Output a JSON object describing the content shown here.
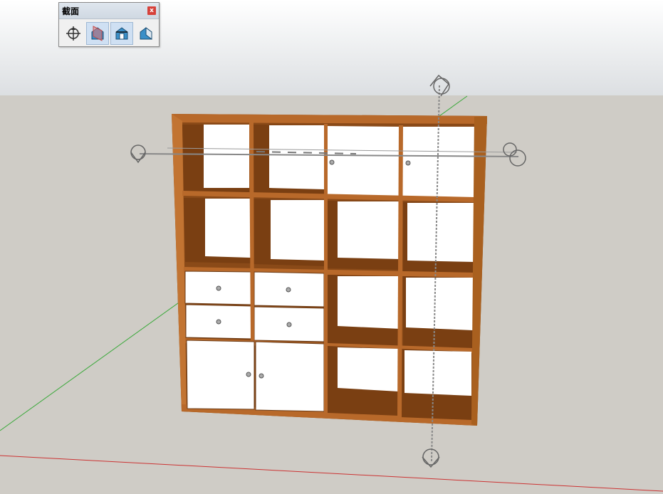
{
  "toolbar": {
    "title": "截面",
    "close_label": "x",
    "tools": [
      {
        "icon": "section-plane-icon",
        "active": false
      },
      {
        "icon": "display-section-planes-icon",
        "active": true
      },
      {
        "icon": "display-section-cuts-icon",
        "active": true
      },
      {
        "icon": "display-section-fill-icon",
        "active": false
      }
    ]
  },
  "colors": {
    "sky": "#dde3e8",
    "ground": "#cfcdc8",
    "wood": "#a9601f",
    "wood_dark": "#6b3a14",
    "door": "#ffffff",
    "red_axis": "#cc3333",
    "green_axis": "#33aa33"
  }
}
